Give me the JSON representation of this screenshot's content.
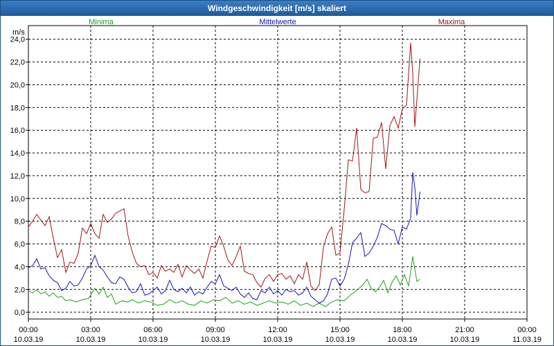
{
  "window": {
    "title": "Windgeschwindigkeit [m/s] skaliert"
  },
  "chart_data": {
    "type": "line",
    "title": "Windgeschwindigkeit [m/s] skaliert",
    "ylabel": "m/s",
    "ylim": [
      -0.6,
      25.2
    ],
    "yticks": [
      "24,0",
      "22,0",
      "20,0",
      "18,0",
      "16,0",
      "14,0",
      "12,0",
      "10,0",
      "8,0",
      "6,0",
      "4,0",
      "2,0",
      "0,0"
    ],
    "ytick_values": [
      24,
      22,
      20,
      18,
      16,
      14,
      12,
      10,
      8,
      6,
      4,
      2,
      0
    ],
    "xlim": [
      0,
      24
    ],
    "xticks": [
      {
        "time": "00:00",
        "date": "10.03.19"
      },
      {
        "time": "03:00",
        "date": "10.03.19"
      },
      {
        "time": "06:00",
        "date": "10.03.19"
      },
      {
        "time": "09:00",
        "date": "10.03.19"
      },
      {
        "time": "12:00",
        "date": "10.03.19"
      },
      {
        "time": "15:00",
        "date": "10.03.19"
      },
      {
        "time": "18:00",
        "date": "10.03.19"
      },
      {
        "time": "21:00",
        "date": "10.03.19"
      },
      {
        "time": "00:00",
        "date": "11.03.19"
      }
    ],
    "grid": true,
    "legend_placement": "top",
    "series": [
      {
        "name": "Minima",
        "color": "#1aa01a",
        "points": [
          [
            0,
            1.9
          ],
          [
            0.2,
            1.7
          ],
          [
            0.4,
            2.0
          ],
          [
            0.6,
            1.6
          ],
          [
            0.8,
            1.8
          ],
          [
            1.0,
            1.4
          ],
          [
            1.2,
            1.7
          ],
          [
            1.4,
            1.3
          ],
          [
            1.6,
            1.4
          ],
          [
            1.8,
            1.0
          ],
          [
            2.0,
            1.1
          ],
          [
            2.3,
            0.9
          ],
          [
            2.6,
            1.1
          ],
          [
            2.9,
            1.2
          ],
          [
            3.0,
            1.5
          ],
          [
            3.2,
            2.1
          ],
          [
            3.4,
            1.6
          ],
          [
            3.6,
            2.2
          ],
          [
            3.8,
            1.3
          ],
          [
            4.0,
            1.6
          ],
          [
            4.2,
            0.7
          ],
          [
            4.5,
            1.0
          ],
          [
            4.8,
            0.9
          ],
          [
            5.0,
            1.1
          ],
          [
            5.3,
            0.8
          ],
          [
            5.6,
            1.0
          ],
          [
            5.9,
            0.9
          ],
          [
            6.2,
            0.6
          ],
          [
            6.5,
            0.7
          ],
          [
            6.8,
            1.1
          ],
          [
            7.1,
            0.8
          ],
          [
            7.4,
            1.0
          ],
          [
            7.7,
            0.7
          ],
          [
            8.0,
            0.6
          ],
          [
            8.3,
            1.0
          ],
          [
            8.6,
            0.8
          ],
          [
            8.9,
            1.1
          ],
          [
            9.2,
            1.0
          ],
          [
            9.5,
            1.3
          ],
          [
            9.8,
            0.8
          ],
          [
            10.1,
            1.0
          ],
          [
            10.4,
            0.7
          ],
          [
            10.7,
            0.9
          ],
          [
            11.0,
            0.6
          ],
          [
            11.3,
            0.8
          ],
          [
            11.6,
            1.0
          ],
          [
            11.9,
            0.8
          ],
          [
            12.2,
            0.9
          ],
          [
            12.5,
            0.7
          ],
          [
            12.8,
            1.0
          ],
          [
            13.1,
            0.6
          ],
          [
            13.4,
            0.8
          ],
          [
            13.7,
            0.5
          ],
          [
            14.0,
            0.8
          ],
          [
            14.3,
            0.5
          ],
          [
            14.6,
            0.9
          ],
          [
            14.9,
            1.1
          ],
          [
            15.2,
            1.0
          ],
          [
            15.5,
            1.5
          ],
          [
            15.8,
            1.9
          ],
          [
            16.1,
            2.4
          ],
          [
            16.3,
            2.9
          ],
          [
            16.5,
            2.1
          ],
          [
            16.7,
            1.8
          ],
          [
            16.9,
            2.2
          ],
          [
            17.1,
            2.8
          ],
          [
            17.3,
            1.7
          ],
          [
            17.5,
            2.6
          ],
          [
            17.7,
            3.2
          ],
          [
            17.9,
            2.4
          ],
          [
            18.1,
            3.3
          ],
          [
            18.3,
            2.3
          ],
          [
            18.5,
            4.9
          ],
          [
            18.7,
            2.7
          ],
          [
            18.85,
            2.9
          ]
        ]
      },
      {
        "name": "Mittelwerte",
        "color": "#1212c0",
        "points": [
          [
            0,
            3.9
          ],
          [
            0.2,
            4.1
          ],
          [
            0.4,
            4.7
          ],
          [
            0.6,
            3.8
          ],
          [
            0.8,
            3.9
          ],
          [
            1.0,
            3.2
          ],
          [
            1.2,
            2.8
          ],
          [
            1.4,
            2.6
          ],
          [
            1.6,
            1.9
          ],
          [
            1.8,
            2.1
          ],
          [
            2.0,
            2.7
          ],
          [
            2.2,
            2.3
          ],
          [
            2.4,
            2.4
          ],
          [
            2.6,
            3.0
          ],
          [
            2.8,
            3.8
          ],
          [
            3.0,
            4.1
          ],
          [
            3.2,
            5.0
          ],
          [
            3.4,
            4.0
          ],
          [
            3.6,
            3.7
          ],
          [
            3.8,
            3.1
          ],
          [
            4.0,
            2.6
          ],
          [
            4.2,
            2.5
          ],
          [
            4.4,
            3.1
          ],
          [
            4.6,
            2.9
          ],
          [
            4.8,
            2.2
          ],
          [
            5.0,
            1.7
          ],
          [
            5.2,
            1.8
          ],
          [
            5.4,
            2.5
          ],
          [
            5.6,
            1.5
          ],
          [
            5.8,
            1.6
          ],
          [
            6.0,
            1.9
          ],
          [
            6.2,
            2.2
          ],
          [
            6.4,
            1.6
          ],
          [
            6.6,
            1.9
          ],
          [
            6.8,
            2.8
          ],
          [
            7.0,
            2.0
          ],
          [
            7.2,
            1.8
          ],
          [
            7.4,
            2.1
          ],
          [
            7.6,
            1.7
          ],
          [
            7.8,
            2.2
          ],
          [
            8.0,
            1.5
          ],
          [
            8.2,
            1.8
          ],
          [
            8.4,
            1.6
          ],
          [
            8.6,
            2.2
          ],
          [
            8.8,
            2.7
          ],
          [
            9.0,
            2.5
          ],
          [
            9.2,
            3.3
          ],
          [
            9.4,
            2.3
          ],
          [
            9.6,
            2.1
          ],
          [
            9.8,
            1.9
          ],
          [
            10.0,
            2.2
          ],
          [
            10.2,
            1.6
          ],
          [
            10.4,
            1.3
          ],
          [
            10.6,
            1.7
          ],
          [
            10.8,
            1.2
          ],
          [
            11.0,
            1.1
          ],
          [
            11.2,
            1.9
          ],
          [
            11.4,
            1.7
          ],
          [
            11.6,
            2.2
          ],
          [
            11.8,
            1.6
          ],
          [
            12.0,
            1.9
          ],
          [
            12.2,
            1.5
          ],
          [
            12.4,
            2.0
          ],
          [
            12.6,
            1.8
          ],
          [
            12.8,
            1.9
          ],
          [
            13.0,
            1.5
          ],
          [
            13.2,
            1.7
          ],
          [
            13.4,
            2.2
          ],
          [
            13.6,
            1.4
          ],
          [
            13.8,
            1.1
          ],
          [
            14.0,
            0.8
          ],
          [
            14.2,
            1.0
          ],
          [
            14.4,
            1.6
          ],
          [
            14.6,
            2.9
          ],
          [
            14.8,
            3.0
          ],
          [
            15.0,
            2.3
          ],
          [
            15.2,
            2.9
          ],
          [
            15.4,
            4.2
          ],
          [
            15.6,
            6.1
          ],
          [
            15.8,
            6.5
          ],
          [
            16.0,
            7.0
          ],
          [
            16.2,
            4.9
          ],
          [
            16.4,
            5.2
          ],
          [
            16.6,
            5.8
          ],
          [
            16.8,
            6.6
          ],
          [
            17.0,
            7.8
          ],
          [
            17.2,
            7.6
          ],
          [
            17.4,
            7.3
          ],
          [
            17.6,
            7.2
          ],
          [
            17.8,
            6.0
          ],
          [
            18.0,
            7.5
          ],
          [
            18.2,
            7.3
          ],
          [
            18.4,
            8.3
          ],
          [
            18.5,
            12.3
          ],
          [
            18.6,
            11.0
          ],
          [
            18.7,
            8.5
          ],
          [
            18.85,
            10.6
          ]
        ]
      },
      {
        "name": "Maxima",
        "color": "#a01414",
        "points": [
          [
            0,
            7.5
          ],
          [
            0.2,
            8.0
          ],
          [
            0.4,
            8.6
          ],
          [
            0.6,
            8.1
          ],
          [
            0.8,
            7.6
          ],
          [
            1.0,
            8.4
          ],
          [
            1.2,
            6.5
          ],
          [
            1.4,
            4.8
          ],
          [
            1.6,
            5.5
          ],
          [
            1.8,
            3.5
          ],
          [
            2.0,
            4.4
          ],
          [
            2.2,
            4.3
          ],
          [
            2.4,
            5.2
          ],
          [
            2.6,
            7.4
          ],
          [
            2.8,
            6.9
          ],
          [
            3.0,
            7.8
          ],
          [
            3.2,
            6.9
          ],
          [
            3.4,
            6.5
          ],
          [
            3.6,
            8.6
          ],
          [
            3.8,
            7.9
          ],
          [
            4.0,
            8.2
          ],
          [
            4.2,
            8.7
          ],
          [
            4.4,
            8.9
          ],
          [
            4.6,
            9.1
          ],
          [
            4.8,
            6.7
          ],
          [
            5.0,
            5.3
          ],
          [
            5.2,
            4.3
          ],
          [
            5.4,
            4.0
          ],
          [
            5.6,
            4.1
          ],
          [
            5.8,
            3.3
          ],
          [
            6.0,
            3.5
          ],
          [
            6.2,
            3.0
          ],
          [
            6.4,
            4.1
          ],
          [
            6.6,
            3.6
          ],
          [
            6.8,
            3.8
          ],
          [
            7.0,
            3.5
          ],
          [
            7.2,
            4.2
          ],
          [
            7.4,
            3.1
          ],
          [
            7.6,
            4.1
          ],
          [
            7.8,
            3.7
          ],
          [
            8.0,
            3.4
          ],
          [
            8.2,
            3.8
          ],
          [
            8.4,
            3.0
          ],
          [
            8.6,
            4.5
          ],
          [
            8.8,
            5.8
          ],
          [
            9.0,
            5.7
          ],
          [
            9.2,
            6.7
          ],
          [
            9.4,
            5.8
          ],
          [
            9.6,
            4.6
          ],
          [
            9.8,
            4.1
          ],
          [
            10.0,
            4.9
          ],
          [
            10.2,
            5.8
          ],
          [
            10.4,
            3.6
          ],
          [
            10.6,
            3.4
          ],
          [
            10.8,
            3.3
          ],
          [
            11.0,
            2.6
          ],
          [
            11.2,
            2.2
          ],
          [
            11.4,
            3.0
          ],
          [
            11.6,
            3.3
          ],
          [
            11.8,
            2.7
          ],
          [
            12.0,
            3.3
          ],
          [
            12.2,
            3.4
          ],
          [
            12.4,
            2.9
          ],
          [
            12.6,
            3.2
          ],
          [
            12.8,
            2.5
          ],
          [
            13.0,
            3.3
          ],
          [
            13.2,
            2.9
          ],
          [
            13.4,
            4.4
          ],
          [
            13.6,
            2.3
          ],
          [
            13.8,
            1.9
          ],
          [
            14.0,
            2.4
          ],
          [
            14.2,
            5.7
          ],
          [
            14.4,
            6.9
          ],
          [
            14.6,
            7.5
          ],
          [
            14.8,
            5.0
          ],
          [
            15.0,
            5.2
          ],
          [
            15.2,
            9.0
          ],
          [
            15.4,
            13.4
          ],
          [
            15.6,
            13.3
          ],
          [
            15.8,
            16.2
          ],
          [
            16.0,
            10.8
          ],
          [
            16.2,
            10.5
          ],
          [
            16.4,
            10.6
          ],
          [
            16.6,
            15.3
          ],
          [
            16.8,
            15.4
          ],
          [
            17.0,
            16.7
          ],
          [
            17.2,
            12.6
          ],
          [
            17.4,
            16.4
          ],
          [
            17.6,
            17.2
          ],
          [
            17.8,
            16.2
          ],
          [
            18.0,
            17.9
          ],
          [
            18.2,
            18.2
          ],
          [
            18.4,
            23.7
          ],
          [
            18.5,
            21.0
          ],
          [
            18.6,
            16.3
          ],
          [
            18.85,
            22.3
          ]
        ]
      }
    ]
  }
}
